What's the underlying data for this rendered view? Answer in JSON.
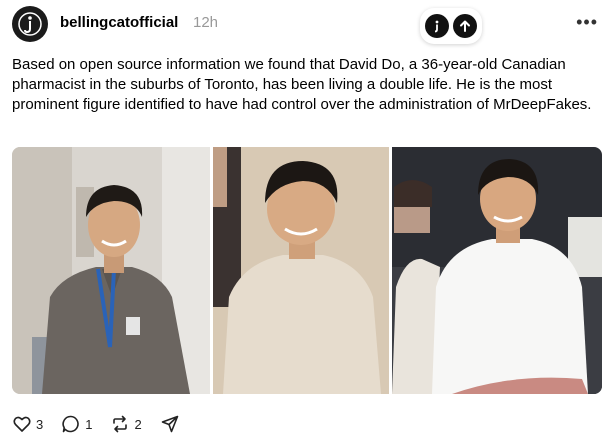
{
  "post": {
    "username": "bellingcatofficial",
    "timestamp": "12h",
    "text": "Based on open source information we found that David Do, a 36-year-old Canadian pharmacist in the suburbs of Toronto, has been living a double life. He is the most prominent figure identified to have had control over the administration of MrDeepFakes."
  },
  "media": {
    "photos": [
      {
        "subject": "man-lanyard-plaid-shirt"
      },
      {
        "subject": "man-beige-sweater"
      },
      {
        "subject": "man-white-tshirt-blurred-person"
      }
    ]
  },
  "actions": {
    "likes": "3",
    "replies": "1",
    "reposts": "2"
  },
  "icons": [
    "logo-icon",
    "info-icon",
    "upload-icon",
    "more-icon",
    "heart-icon",
    "comment-icon",
    "repost-icon",
    "share-icon"
  ]
}
